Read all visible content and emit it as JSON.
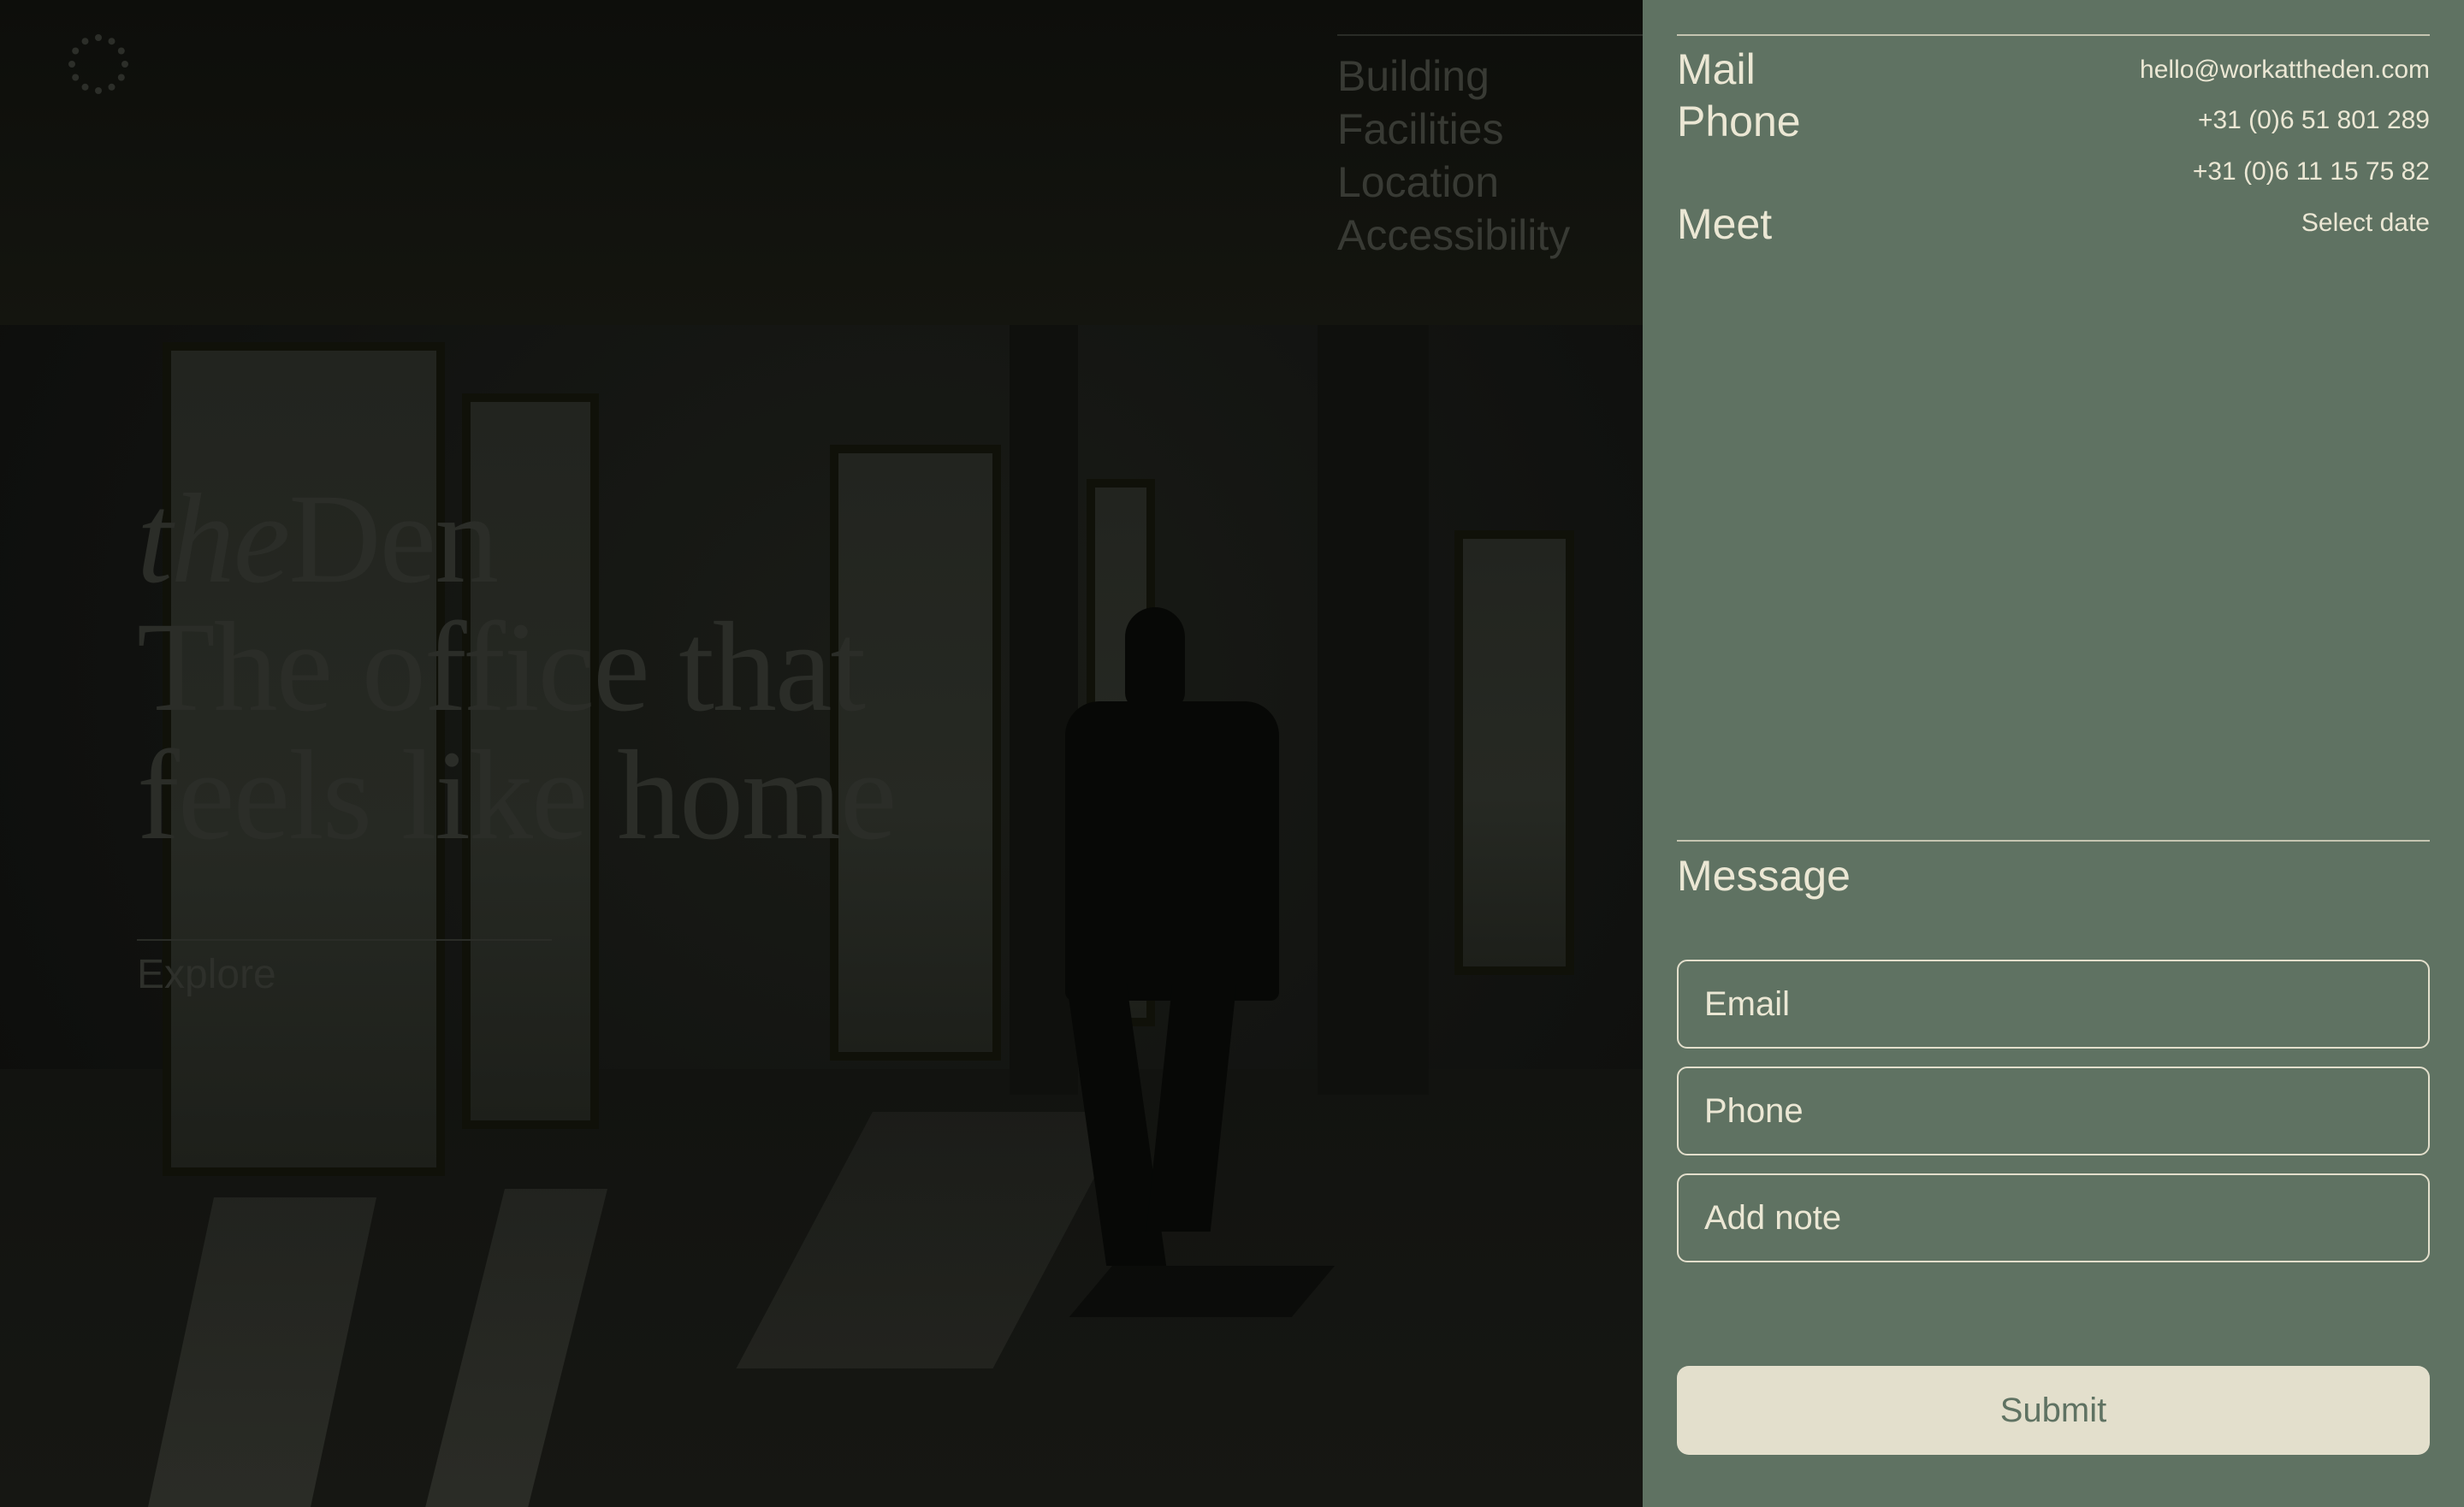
{
  "brand": {
    "prefix": "the",
    "name": "Den"
  },
  "hero": {
    "tagline_line1": "The office that",
    "tagline_line2": "feels like home",
    "explore_label": "Explore"
  },
  "nav": {
    "items": [
      {
        "label": "Building"
      },
      {
        "label": "Facilities"
      },
      {
        "label": "Location"
      },
      {
        "label": "Accessibility"
      }
    ]
  },
  "contact": {
    "mail_label": "Mail",
    "mail_value": "hello@workattheden.com",
    "phone_label": "Phone",
    "phone_value_1": "+31 (0)6 51 801 289",
    "phone_value_2": "+31 (0)6 11 15 75 82",
    "meet_label": "Meet",
    "meet_value": "Select date"
  },
  "form": {
    "title": "Message",
    "email_placeholder": "Email",
    "phone_placeholder": "Phone",
    "note_placeholder": "Add note",
    "submit_label": "Submit"
  },
  "colors": {
    "panel_background": "#5f7262",
    "panel_text": "#e3dfcc",
    "submit_background": "#e3dfcc",
    "hero_overlay": "#0c0d0a"
  },
  "icons": {
    "logo": "dotted-circle-logo-icon"
  }
}
